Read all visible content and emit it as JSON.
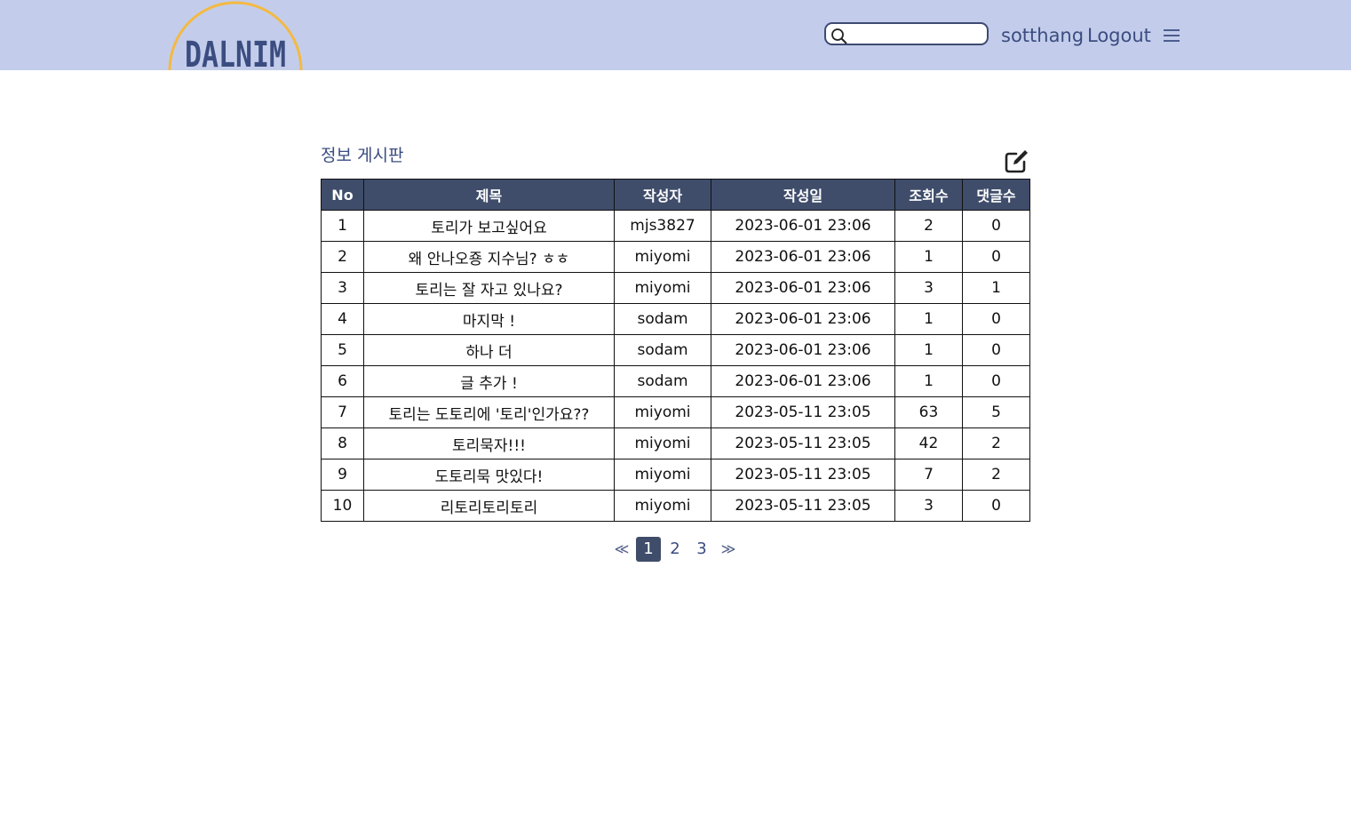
{
  "header": {
    "logo_text": "DALNIM",
    "search_placeholder": "",
    "username": "sotthang",
    "logout_label": "Logout",
    "menu_icon": "hamburger-menu-icon",
    "search_icon": "search-icon"
  },
  "board": {
    "title": "정보 게시판",
    "write_icon": "pencil-edit-icon",
    "columns": [
      "No",
      "제목",
      "작성자",
      "작성일",
      "조회수",
      "댓글수"
    ],
    "rows": [
      [
        "1",
        "토리가 보고싶어요",
        "mjs3827",
        "2023-06-01 23:06",
        "2",
        "0"
      ],
      [
        "2",
        "왜 안나오죵 지수님? ㅎㅎ",
        "miyomi",
        "2023-06-01 23:06",
        "1",
        "0"
      ],
      [
        "3",
        "토리는 잘 자고 있나요?",
        "miyomi",
        "2023-06-01 23:06",
        "3",
        "1"
      ],
      [
        "4",
        "마지막 !",
        "sodam",
        "2023-06-01 23:06",
        "1",
        "0"
      ],
      [
        "5",
        "하나 더",
        "sodam",
        "2023-06-01 23:06",
        "1",
        "0"
      ],
      [
        "6",
        "글 추가 !",
        "sodam",
        "2023-06-01 23:06",
        "1",
        "0"
      ],
      [
        "7",
        "토리는 도토리에 '토리'인가요??",
        "miyomi",
        "2023-05-11 23:05",
        "63",
        "5"
      ],
      [
        "8",
        "토리묵자!!!",
        "miyomi",
        "2023-05-11 23:05",
        "42",
        "2"
      ],
      [
        "9",
        "도토리묵 맛있다!",
        "miyomi",
        "2023-05-11 23:05",
        "7",
        "2"
      ],
      [
        "10",
        "리토리토리토리",
        "miyomi",
        "2023-05-11 23:05",
        "3",
        "0"
      ]
    ]
  },
  "pagination": {
    "first": "≪",
    "pages": [
      "1",
      "2",
      "3"
    ],
    "current": "1",
    "last": "≫"
  },
  "colors": {
    "header_bg": "#c3cdeb",
    "accent": "#3b4c80",
    "table_header_bg": "#3f4d6b",
    "logo_arc": "#f4b942"
  }
}
